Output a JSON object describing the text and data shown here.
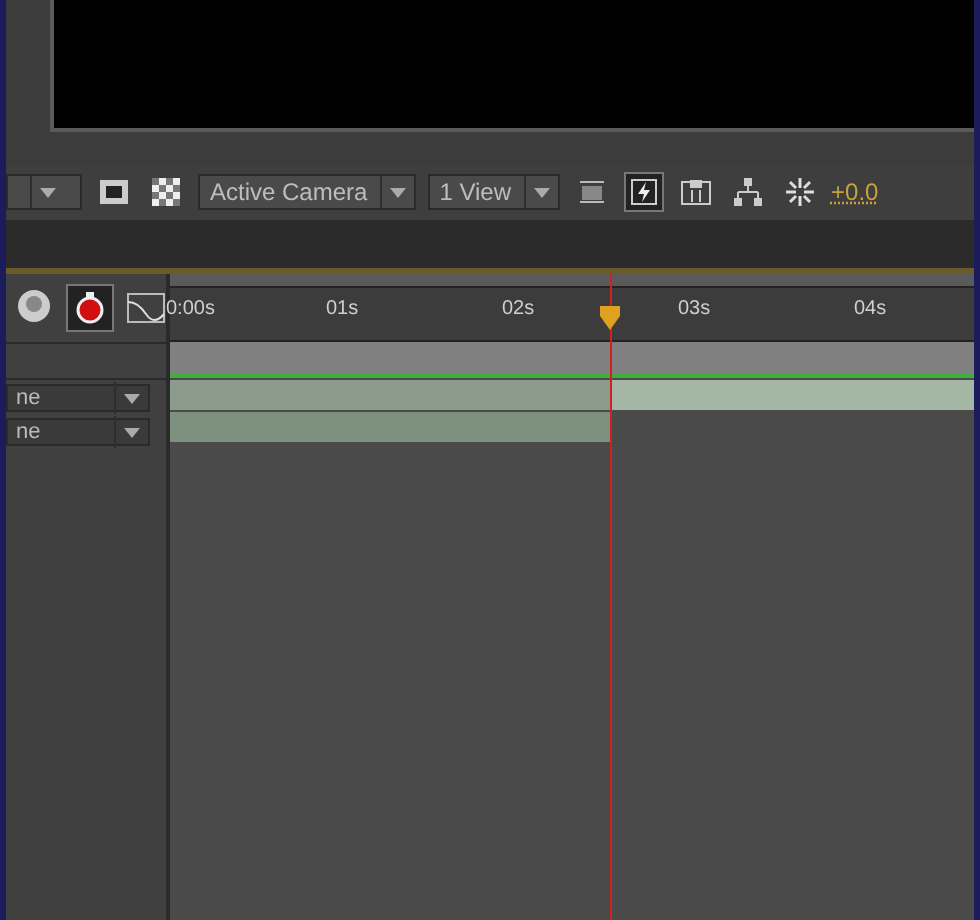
{
  "viewer_toolbar": {
    "camera": "Active Camera",
    "views": "1 View",
    "exposure": "+0.0",
    "fast_preview_on": true
  },
  "timeline": {
    "motion_blur_on": true,
    "ruler": [
      "0:00s",
      "01s",
      "02s",
      "03s",
      "04s"
    ],
    "playhead": {
      "level": 0.5
    },
    "layers": [
      {
        "mode": "ne"
      },
      {
        "mode": "ne"
      }
    ]
  }
}
